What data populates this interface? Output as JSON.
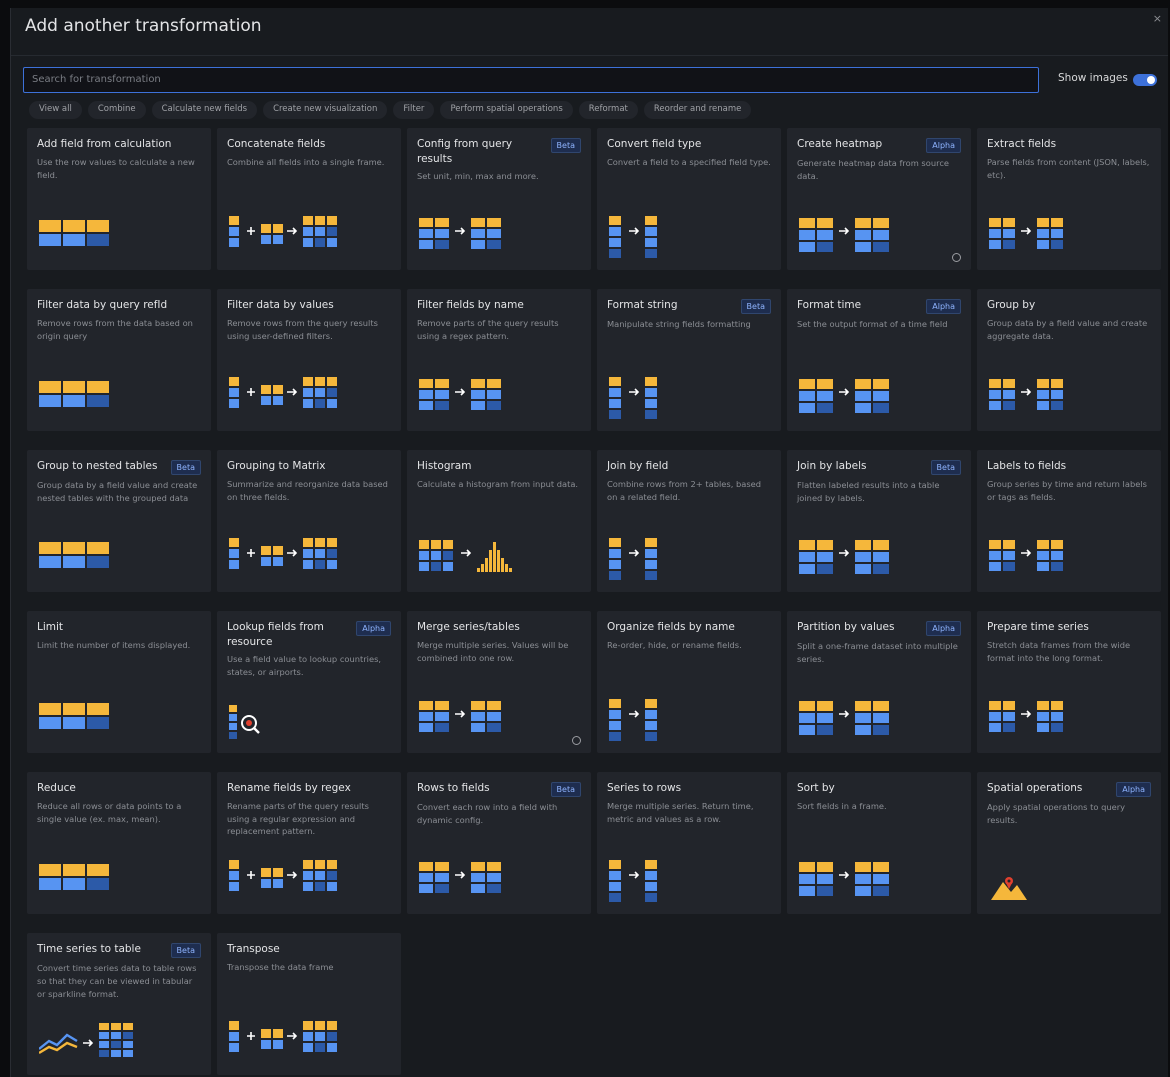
{
  "drawer": {
    "title": "Add another transformation",
    "close_icon": "×"
  },
  "search": {
    "placeholder": "Search for transformation"
  },
  "show_images": {
    "label": "Show images",
    "checked": true
  },
  "filters": [
    "View all",
    "Combine",
    "Calculate new fields",
    "Create new visualization",
    "Filter",
    "Perform spatial operations",
    "Reformat",
    "Reorder and rename"
  ],
  "colors": {
    "yellow": "#f5b73b",
    "blue": "#5794f2",
    "navy": "#2c5aa8",
    "accent": "#3d71d9"
  },
  "cards": [
    {
      "title": "Add field from calculation",
      "badge": "",
      "desc": "Use the row values to calculate a new field.",
      "icon": "calc-fields-icon"
    },
    {
      "title": "Concatenate fields",
      "badge": "",
      "desc": "Combine all fields into a single frame.",
      "icon": "concatenate-icon"
    },
    {
      "title": "Config from query results",
      "badge": "Beta",
      "desc": "Set unit, min, max and more.",
      "icon": "config-query-icon"
    },
    {
      "title": "Convert field type",
      "badge": "",
      "desc": "Convert a field to a specified field type.",
      "icon": "convert-type-icon"
    },
    {
      "title": "Create heatmap",
      "badge": "Alpha",
      "desc": "Generate heatmap data from source data.",
      "icon": "heatmap-icon",
      "info": true
    },
    {
      "title": "Extract fields",
      "badge": "",
      "desc": "Parse fields from content (JSON, labels, etc).",
      "icon": "extract-fields-icon"
    },
    {
      "title": "Filter data by query refId",
      "badge": "",
      "desc": "Remove rows from the data based on origin query",
      "icon": "filter-refid-icon"
    },
    {
      "title": "Filter data by values",
      "badge": "",
      "desc": "Remove rows from the query results using user-defined filters.",
      "icon": "filter-values-icon"
    },
    {
      "title": "Filter fields by name",
      "badge": "",
      "desc": "Remove parts of the query results using a regex pattern.",
      "icon": "filter-name-icon"
    },
    {
      "title": "Format string",
      "badge": "Beta",
      "desc": "Manipulate string fields formatting",
      "icon": "format-string-icon"
    },
    {
      "title": "Format time",
      "badge": "Alpha",
      "desc": "Set the output format of a time field",
      "icon": "format-time-icon"
    },
    {
      "title": "Group by",
      "badge": "",
      "desc": "Group data by a field value and create aggregate data.",
      "icon": "group-by-icon"
    },
    {
      "title": "Group to nested tables",
      "badge": "Beta",
      "desc": "Group data by a field value and create nested tables with the grouped data",
      "icon": "nested-tables-icon"
    },
    {
      "title": "Grouping to Matrix",
      "badge": "",
      "desc": "Summarize and reorganize data based on three fields.",
      "icon": "matrix-icon"
    },
    {
      "title": "Histogram",
      "badge": "",
      "desc": "Calculate a histogram from input data.",
      "icon": "histogram-icon"
    },
    {
      "title": "Join by field",
      "badge": "",
      "desc": "Combine rows from 2+ tables, based on a related field.",
      "icon": "join-field-icon"
    },
    {
      "title": "Join by labels",
      "badge": "Beta",
      "desc": "Flatten labeled results into a table joined by labels.",
      "icon": "join-labels-icon"
    },
    {
      "title": "Labels to fields",
      "badge": "",
      "desc": "Group series by time and return labels or tags as fields.",
      "icon": "labels-fields-icon"
    },
    {
      "title": "Limit",
      "badge": "",
      "desc": "Limit the number of items displayed.",
      "icon": "limit-icon"
    },
    {
      "title": "Lookup fields from resource",
      "badge": "Alpha",
      "desc": "Use a field value to lookup countries, states, or airports.",
      "icon": "lookup-icon"
    },
    {
      "title": "Merge series/tables",
      "badge": "",
      "desc": "Merge multiple series. Values will be combined into one row.",
      "icon": "merge-icon",
      "info": true
    },
    {
      "title": "Organize fields by name",
      "badge": "",
      "desc": "Re-order, hide, or rename fields.",
      "icon": "organize-icon"
    },
    {
      "title": "Partition by values",
      "badge": "Alpha",
      "desc": "Split a one-frame dataset into multiple series.",
      "icon": "partition-icon"
    },
    {
      "title": "Prepare time series",
      "badge": "",
      "desc": "Stretch data frames from the wide format into the long format.",
      "icon": "prepare-ts-icon"
    },
    {
      "title": "Reduce",
      "badge": "",
      "desc": "Reduce all rows or data points to a single value (ex. max, mean).",
      "icon": "reduce-icon"
    },
    {
      "title": "Rename fields by regex",
      "badge": "",
      "desc": "Rename parts of the query results using a regular expression and replacement pattern.",
      "icon": "rename-regex-icon"
    },
    {
      "title": "Rows to fields",
      "badge": "Beta",
      "desc": "Convert each row into a field with dynamic config.",
      "icon": "rows-fields-icon"
    },
    {
      "title": "Series to rows",
      "badge": "",
      "desc": "Merge multiple series. Return time, metric and values as a row.",
      "icon": "series-rows-icon"
    },
    {
      "title": "Sort by",
      "badge": "",
      "desc": "Sort fields in a frame.",
      "icon": "sort-icon"
    },
    {
      "title": "Spatial operations",
      "badge": "Alpha",
      "desc": "Apply spatial operations to query results.",
      "icon": "map-pin-icon"
    },
    {
      "title": "Time series to table",
      "badge": "Beta",
      "desc": "Convert time series data to table rows so that they can be viewed in tabular or sparkline format.",
      "icon": "ts-table-icon"
    },
    {
      "title": "Transpose",
      "badge": "",
      "desc": "Transpose the data frame",
      "icon": "transpose-icon"
    }
  ]
}
